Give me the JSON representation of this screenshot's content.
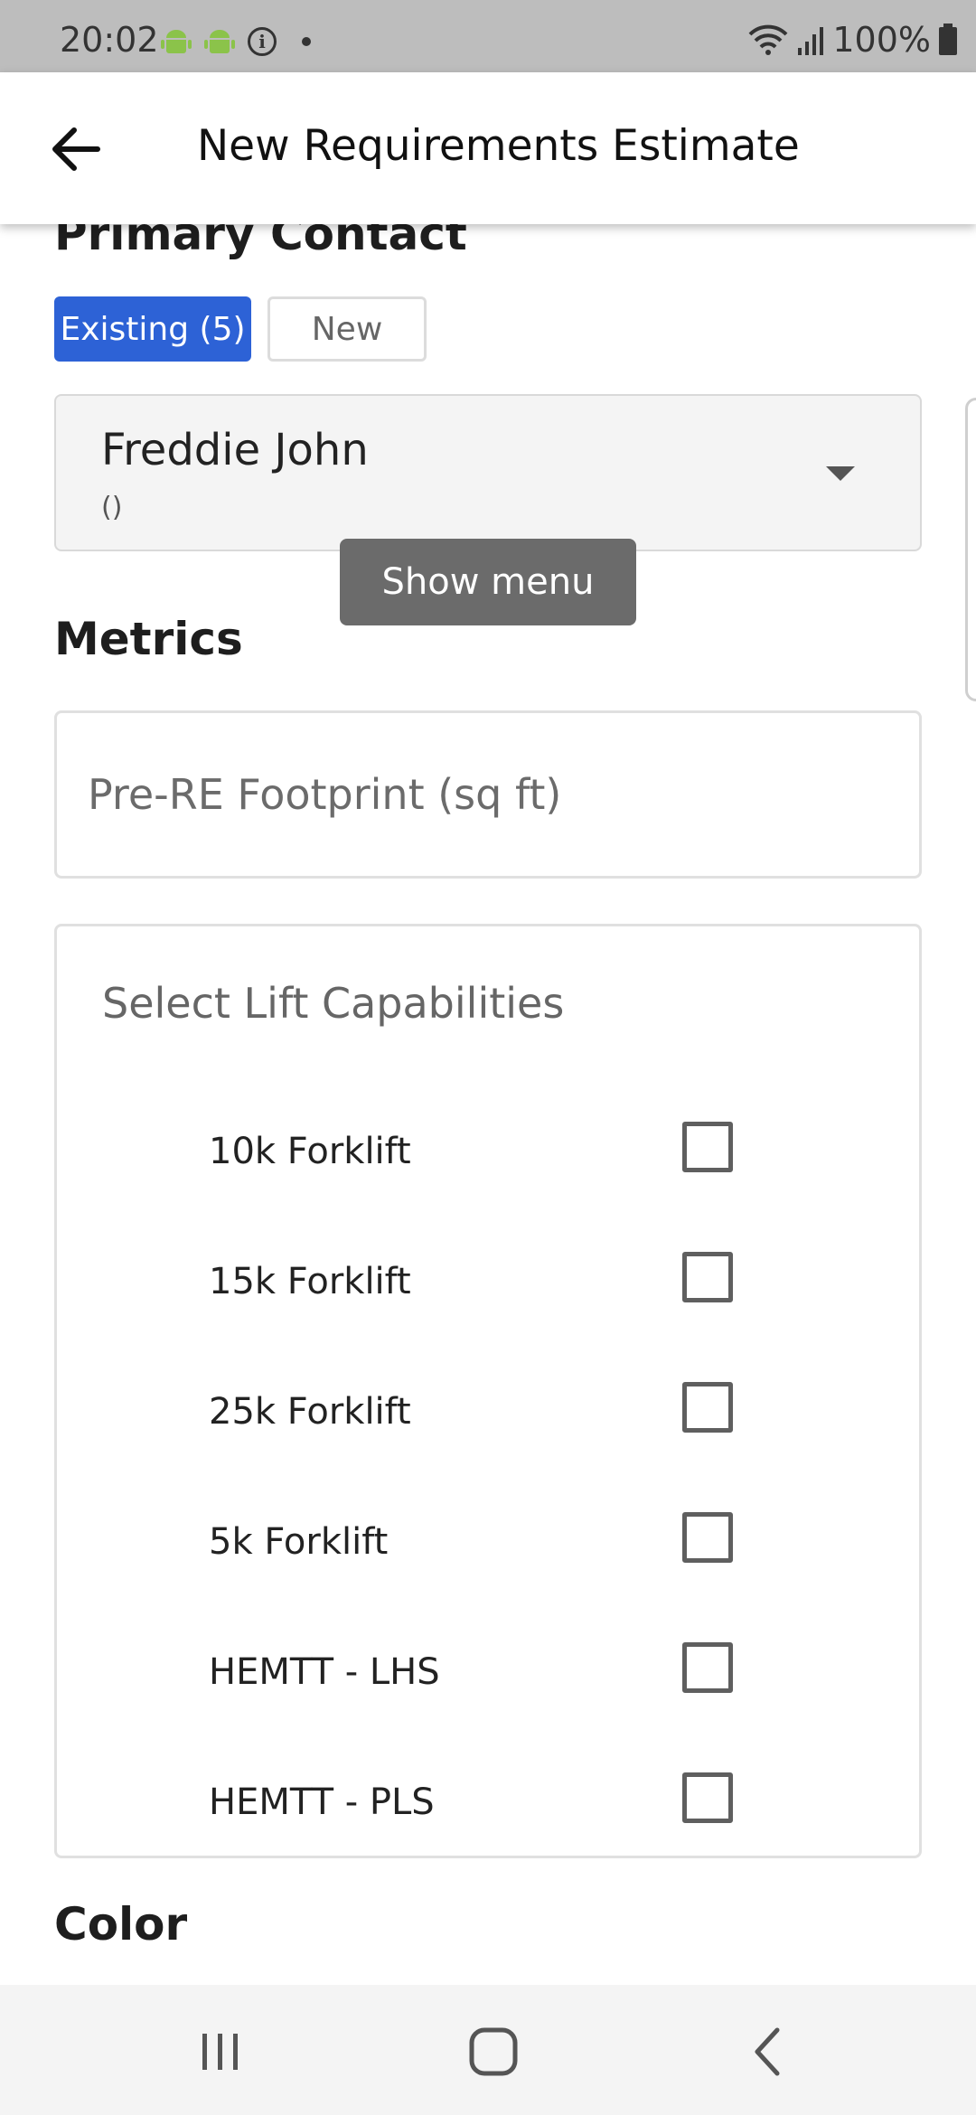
{
  "status_bar": {
    "time": "20:02",
    "battery": "100%",
    "icons": [
      "android-icon",
      "android-icon",
      "info-icon",
      "dot-icon",
      "wifi-icon",
      "signal-icon",
      "battery-icon"
    ]
  },
  "app_bar": {
    "title": "New Requirements Estimate",
    "back_icon": "arrow-left-icon"
  },
  "primary_contact": {
    "heading": "Primary Contact",
    "existing_label": "Existing (5)",
    "new_label": "New",
    "selected_name": "Freddie John",
    "selected_sub": "()"
  },
  "tooltip": {
    "text": "Show menu"
  },
  "metrics": {
    "heading": "Metrics",
    "footprint_placeholder": "Pre-RE Footprint (sq ft)",
    "footprint_value": ""
  },
  "lift": {
    "title": "Select Lift Capabilities",
    "items": [
      {
        "label": "10k Forklift",
        "checked": false
      },
      {
        "label": "15k Forklift",
        "checked": false
      },
      {
        "label": "25k Forklift",
        "checked": false
      },
      {
        "label": "5k Forklift",
        "checked": false
      },
      {
        "label": "HEMTT - LHS",
        "checked": false
      },
      {
        "label": "HEMTT - PLS",
        "checked": false
      }
    ]
  },
  "color": {
    "heading": "Color"
  },
  "nav_bar": {
    "icons": [
      "recents-icon",
      "home-icon",
      "back-icon"
    ]
  },
  "colors": {
    "accent": "#2d62d6",
    "status_bar": "#bdbdbd",
    "tooltip": "#6b6b6b"
  }
}
